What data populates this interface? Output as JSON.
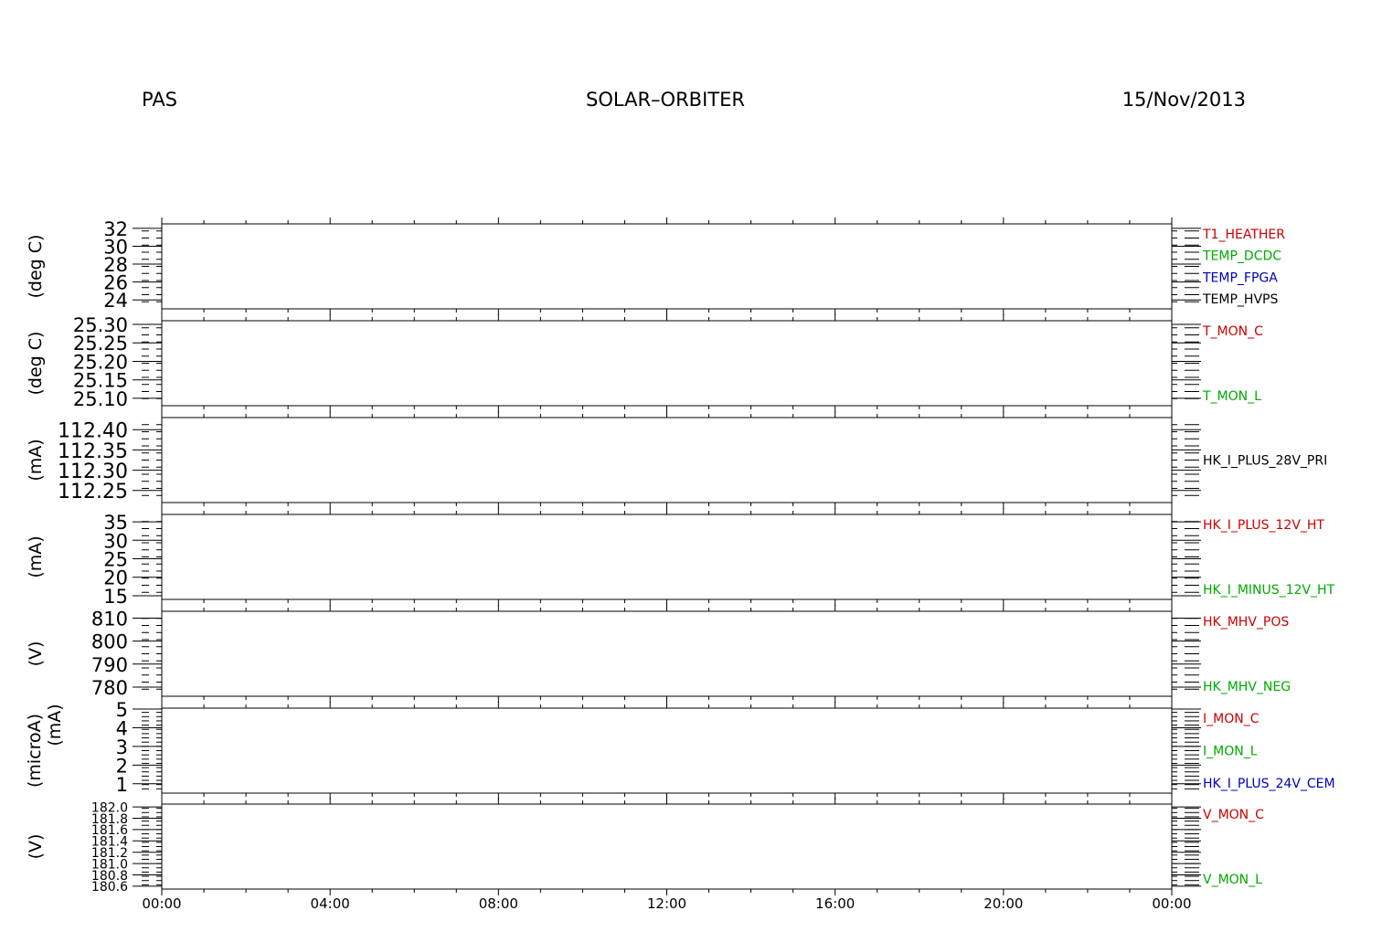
{
  "header": {
    "left": "PAS",
    "center": "SOLAR–ORBITER",
    "right": "15/Nov/2013"
  },
  "chart_data": {
    "type": "line",
    "xlabel": "",
    "x_ticks": [
      "00:00",
      "04:00",
      "08:00",
      "12:00",
      "16:00",
      "20:00",
      "00:00"
    ],
    "grid": false,
    "panels": [
      {
        "unit": "(deg C)",
        "ylim": [
          23,
          32.5
        ],
        "yticks": [
          "24",
          "26",
          "28",
          "30",
          "32"
        ],
        "ytick_values": [
          24,
          26,
          28,
          30,
          32
        ],
        "series": [
          {
            "name": "T1_HEATHER",
            "color": "#cc0000",
            "values": []
          },
          {
            "name": "TEMP_DCDC",
            "color": "#00aa00",
            "values": []
          },
          {
            "name": "TEMP_FPGA",
            "color": "#0000bb",
            "values": []
          },
          {
            "name": "TEMP_HVPS",
            "color": "#000000",
            "values": []
          }
        ]
      },
      {
        "unit": "(deg C)",
        "ylim": [
          25.08,
          25.31
        ],
        "yticks": [
          "25.10",
          "25.15",
          "25.20",
          "25.25",
          "25.30"
        ],
        "ytick_values": [
          25.1,
          25.15,
          25.2,
          25.25,
          25.3
        ],
        "series": [
          {
            "name": "T_MON_C",
            "color": "#cc0000",
            "values": []
          },
          {
            "name": "T_MON_L",
            "color": "#00aa00",
            "values": []
          }
        ]
      },
      {
        "unit": "(mA)",
        "ylim": [
          112.22,
          112.43
        ],
        "yticks": [
          "112.25",
          "112.30",
          "112.35",
          "112.40"
        ],
        "ytick_values": [
          112.25,
          112.3,
          112.35,
          112.4
        ],
        "series": [
          {
            "name": "HK_I_PLUS_28V_PRI",
            "color": "#000000",
            "values": []
          }
        ]
      },
      {
        "unit": "(mA)",
        "ylim": [
          14,
          37
        ],
        "yticks": [
          "15",
          "20",
          "25",
          "30",
          "35"
        ],
        "ytick_values": [
          15,
          20,
          25,
          30,
          35
        ],
        "series": [
          {
            "name": "HK_I_PLUS_12V_HT",
            "color": "#cc0000",
            "values": []
          },
          {
            "name": "HK_I_MINUS_12V_HT",
            "color": "#00aa00",
            "values": []
          }
        ]
      },
      {
        "unit": "(V)",
        "ylim": [
          776,
          813
        ],
        "yticks": [
          "780",
          "790",
          "800",
          "810"
        ],
        "ytick_values": [
          780,
          790,
          800,
          810
        ],
        "series": [
          {
            "name": "HK_MHV_POS",
            "color": "#cc0000",
            "values": []
          },
          {
            "name": "HK_MHV_NEG",
            "color": "#00aa00",
            "values": []
          }
        ]
      },
      {
        "unit": "(microA)",
        "unit2": "(mA)",
        "ylim": [
          0.5,
          5.05
        ],
        "yticks": [
          "1",
          "2",
          "3",
          "4",
          "5"
        ],
        "ytick_values": [
          1,
          2,
          3,
          4,
          5
        ],
        "series": [
          {
            "name": "I_MON_C",
            "color": "#cc0000",
            "values": []
          },
          {
            "name": "I_MON_L",
            "color": "#00aa00",
            "values": []
          },
          {
            "name": "HK_I_PLUS_24V_CEM",
            "color": "#0000bb",
            "values": []
          }
        ]
      },
      {
        "unit": "(V)",
        "ylim": [
          180.55,
          182.05
        ],
        "yticks": [
          "180.6",
          "180.8",
          "181.0",
          "181.2",
          "181.4",
          "181.6",
          "181.8",
          "182.0"
        ],
        "ytick_values": [
          180.6,
          180.8,
          181.0,
          181.2,
          181.4,
          181.6,
          181.8,
          182.0
        ],
        "series": [
          {
            "name": "V_MON_C",
            "color": "#cc0000",
            "values": []
          },
          {
            "name": "V_MON_L",
            "color": "#00aa00",
            "values": []
          }
        ]
      }
    ]
  }
}
